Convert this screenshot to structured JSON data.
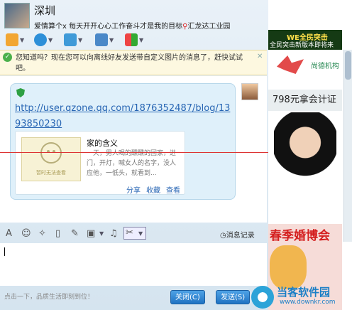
{
  "window": {
    "contact_name": "深圳",
    "signature_prefix": "爱情算个x 每天开开心心工作奋斗才是我的目标",
    "signature_location": "汇龙达工业园",
    "controls": [
      "▢",
      "–",
      "✕"
    ]
  },
  "toolbar_top": {
    "icons": [
      "microphone-icon",
      "video-icon",
      "file-transfer-icon",
      "screen-share-icon",
      "apps-icon"
    ]
  },
  "notice": {
    "text": "您知道吗？现在您可以向离线好友发送带自定义图片的消息了，赶快试试吧。",
    "close": "✕"
  },
  "message": {
    "link": "http://user.qzone.qq.com/1876352487/blog/1393850230",
    "card": {
      "title": "家的含义",
      "summary": "一天，男人喝的醺醺的回家，进门，开灯，喊女人的名字，没人应他，一低头，就看到...",
      "thumb_caption": "暂时无法查看",
      "actions": [
        "分享",
        "收藏",
        "查看"
      ]
    }
  },
  "toolbar_bottom": {
    "history_label": "消息记录",
    "icons": [
      "font-icon",
      "emoji-icon",
      "magic-icon",
      "crop-icon",
      "edit-icon",
      "image-icon",
      "music-icon",
      "scissors-icon"
    ]
  },
  "bottom": {
    "tip": "点击一下，品质生活即刻到位！",
    "close_label": "关闭(C)",
    "send_label": "发送(S)"
  },
  "ads": {
    "game_banner": "全民突击新版本即将来",
    "game_logo": "WE全民突击",
    "brand": "尚德机构",
    "price": "798元拿会计证",
    "wedding": "春季婚博会"
  },
  "watermark": {
    "name": "当客软件园",
    "url": "www.downkr.com"
  },
  "colors": {
    "link": "#2866b4",
    "button": "#1f72c2",
    "bubble": "#dff0fa"
  }
}
